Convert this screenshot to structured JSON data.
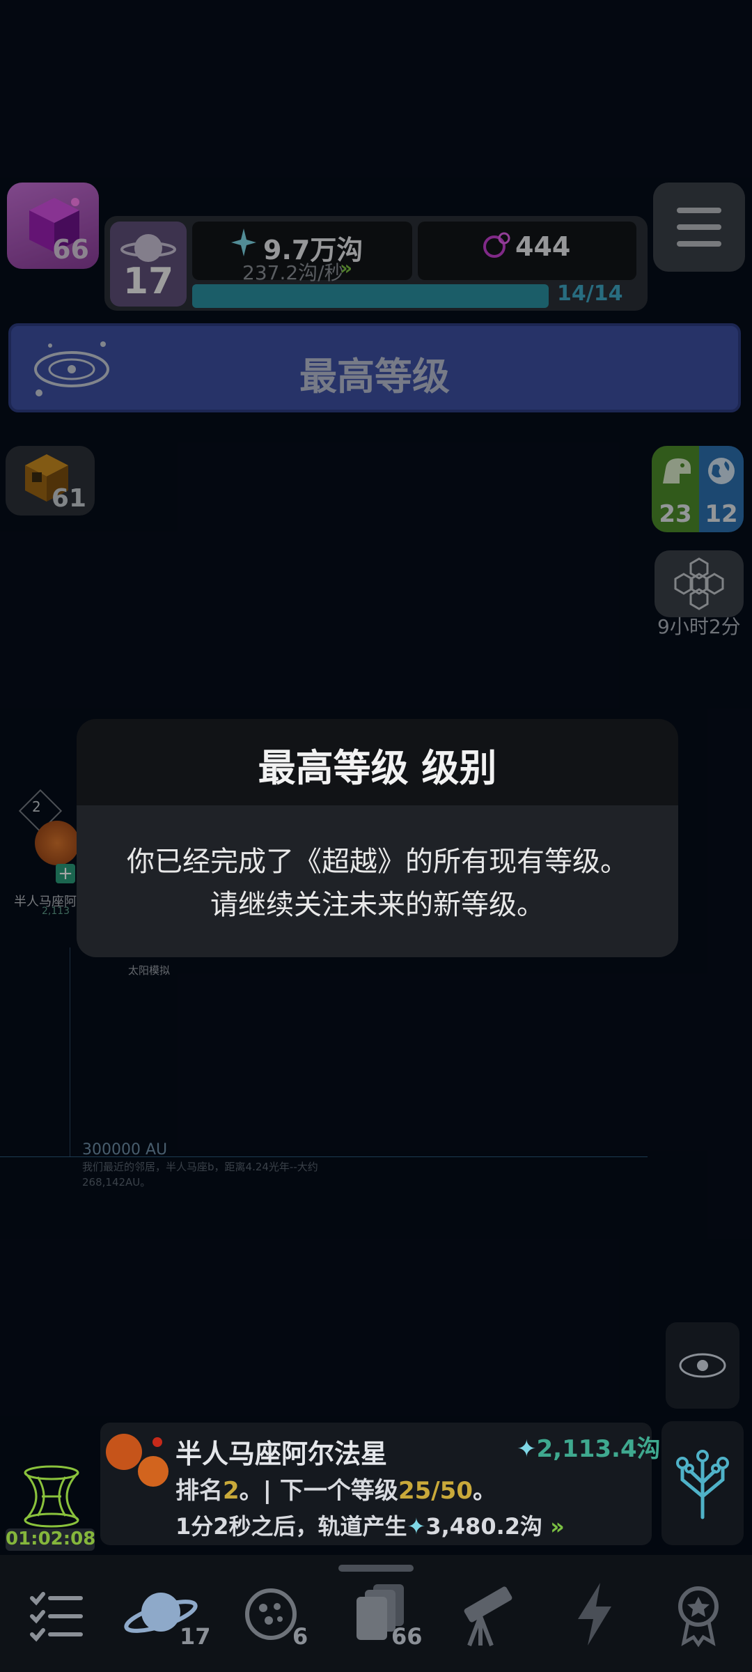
{
  "top_left": {
    "cube_count": "66",
    "icon": "purple-cube-icon"
  },
  "stats": {
    "level": "17",
    "currency_value": "9.7万沟",
    "currency_rate": "237.2沟/秒",
    "gems": "444",
    "progress": "14/14",
    "progress_fraction": 1.0
  },
  "banner": {
    "title": "最高等级"
  },
  "left_panel": {
    "hex_count": "61"
  },
  "right_panel": {
    "dino_count": "23",
    "earth_count": "12",
    "timer": "9小时2分"
  },
  "modal": {
    "title": "最高等级 级别",
    "line1": "你已经完成了《超越》的所有现有等级。",
    "line2": "请继续关注未来的新等级。"
  },
  "background": {
    "diamond_num": "2",
    "left_label": "半人马座阿",
    "left_sub": "2,113",
    "tiny_label": "太阳模拟",
    "au_label": "300000 AU",
    "au_desc1": "我们最近的邻居，半人马座b，距离4.24光年--大约",
    "au_desc2": "268,142AU。"
  },
  "info_card": {
    "name": "半人马座阿尔法星",
    "amount": "2,113.4沟",
    "rank_prefix": "排名",
    "rank_value": "2",
    "rank_mid": "。| 下一个等级",
    "rank_next": "25/50",
    "rank_suffix": "。",
    "orbit_text": "1分2秒之后，轨道产生",
    "orbit_amount": "3,480.2沟"
  },
  "wormhole": {
    "timer": "01:02:08"
  },
  "bottom_nav": {
    "items": [
      {
        "icon": "checklist-icon",
        "count": ""
      },
      {
        "icon": "planet-icon",
        "count": "17"
      },
      {
        "icon": "moons-icon",
        "count": "6"
      },
      {
        "icon": "cards-icon",
        "count": "66"
      },
      {
        "icon": "telescope-icon",
        "count": ""
      },
      {
        "icon": "lightning-icon",
        "count": ""
      },
      {
        "icon": "award-icon",
        "count": ""
      }
    ]
  },
  "colors": {
    "banner": "#3c4fa0",
    "progress": "#2a8fa0",
    "accent_green": "#3fa98f",
    "highlight": "#c9a93a"
  }
}
